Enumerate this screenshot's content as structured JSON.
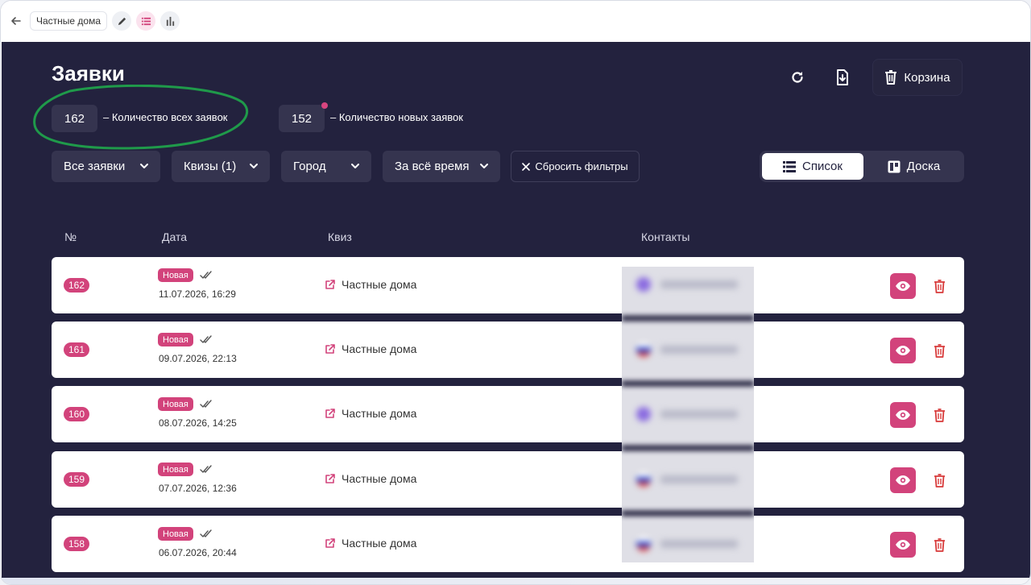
{
  "toolbar": {
    "title": "Частные дома"
  },
  "header": {
    "title": "Заявки",
    "trash_label": "Корзина"
  },
  "stats": {
    "total_value": "162",
    "total_label": "– Количество всех заявок",
    "new_value": "152",
    "new_label": "– Количество новых заявок"
  },
  "filters": {
    "all_requests": "Все заявки",
    "quizzes": "Квизы (1)",
    "city": "Город",
    "period": "За всё время",
    "reset": "Сбросить фильтры"
  },
  "view_toggle": {
    "list": "Список",
    "board": "Доска"
  },
  "table": {
    "columns": [
      "№",
      "Дата",
      "Квиз",
      "Контакты"
    ],
    "rows": [
      {
        "num": "162",
        "status": "Новая",
        "date": "11.07.2026, 16:29",
        "quiz": "Частные дома"
      },
      {
        "num": "161",
        "status": "Новая",
        "date": "09.07.2026, 22:13",
        "quiz": "Частные дома"
      },
      {
        "num": "160",
        "status": "Новая",
        "date": "08.07.2026, 14:25",
        "quiz": "Частные дома"
      },
      {
        "num": "159",
        "status": "Новая",
        "date": "07.07.2026, 12:36",
        "quiz": "Частные дома"
      },
      {
        "num": "158",
        "status": "Новая",
        "date": "06.07.2026, 20:44",
        "quiz": "Частные дома"
      }
    ]
  },
  "colors": {
    "panel": "#23223e",
    "accent": "#d2437b",
    "annotation": "#1f9a4a"
  }
}
